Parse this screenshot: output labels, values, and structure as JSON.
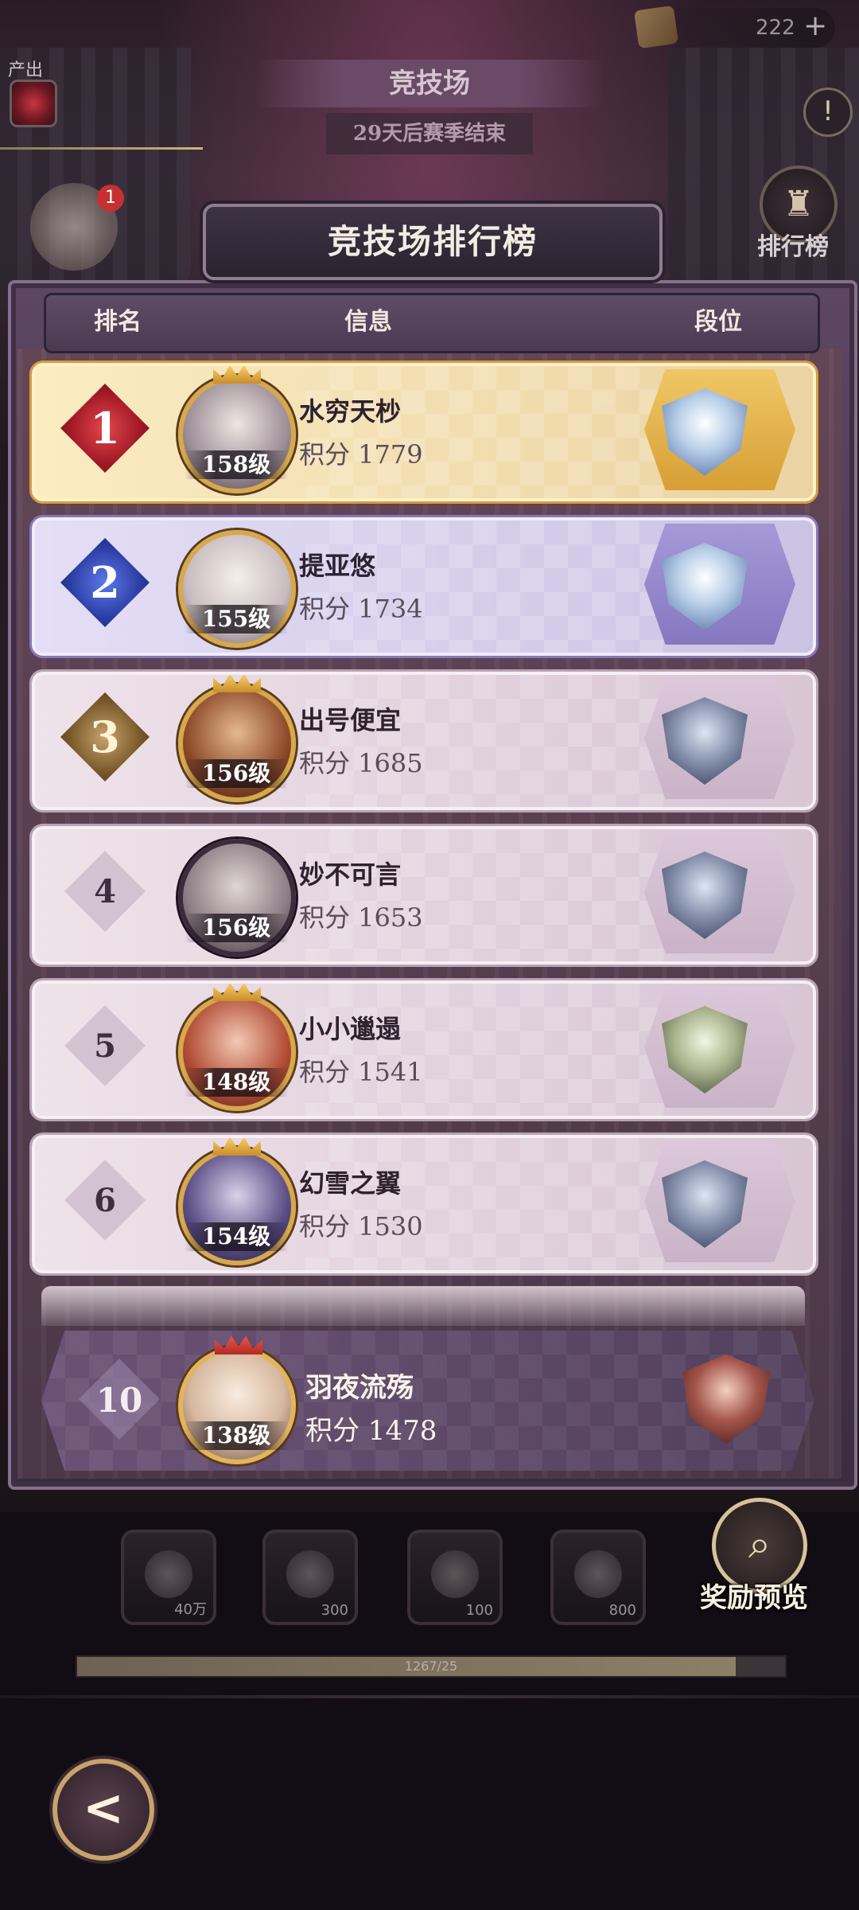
{
  "top_bar": {
    "currency_amount": "222",
    "currency_plus": "+",
    "arena_title": "竞技场",
    "season_text": "29天后赛季结束",
    "output_label": "产出",
    "side_badge": "1",
    "info_icon": "!",
    "ranking_entry_label": "排行榜"
  },
  "panel": {
    "title": "竞技场排行榜",
    "headers": {
      "rank": "排名",
      "info": "信息",
      "tier": "段位"
    }
  },
  "rows": [
    {
      "rank": "1",
      "name": "水穷天杪",
      "level": "158级",
      "score": "积分 1779",
      "style": "gold",
      "emblem": "light"
    },
    {
      "rank": "2",
      "name": "提亚悠",
      "level": "155级",
      "score": "积分 1734",
      "style": "silver",
      "emblem": "light"
    },
    {
      "rank": "3",
      "name": "出号便宜",
      "level": "156级",
      "score": "积分 1685",
      "style": "normal",
      "emblem": "dark"
    },
    {
      "rank": "4",
      "name": "妙不可言",
      "level": "156级",
      "score": "积分 1653",
      "style": "normal",
      "emblem": "dark"
    },
    {
      "rank": "5",
      "name": "小小邋遢",
      "level": "148级",
      "score": "积分 1541",
      "style": "normal",
      "emblem": "green"
    },
    {
      "rank": "6",
      "name": "幻雪之翼",
      "level": "154级",
      "score": "积分 1530",
      "style": "normal",
      "emblem": "dark"
    }
  ],
  "self_row": {
    "rank": "10",
    "name": "羽夜流殇",
    "level": "138级",
    "score": "积分 1478"
  },
  "rewards": {
    "slots": [
      {
        "qty": "40万"
      },
      {
        "qty": "300"
      },
      {
        "qty": "100"
      },
      {
        "qty": "800"
      }
    ],
    "progress_text": "1267/25",
    "progress_fraction": 0.93,
    "preview_label": "奖励预览"
  },
  "back_icon": "back-arrow-icon"
}
